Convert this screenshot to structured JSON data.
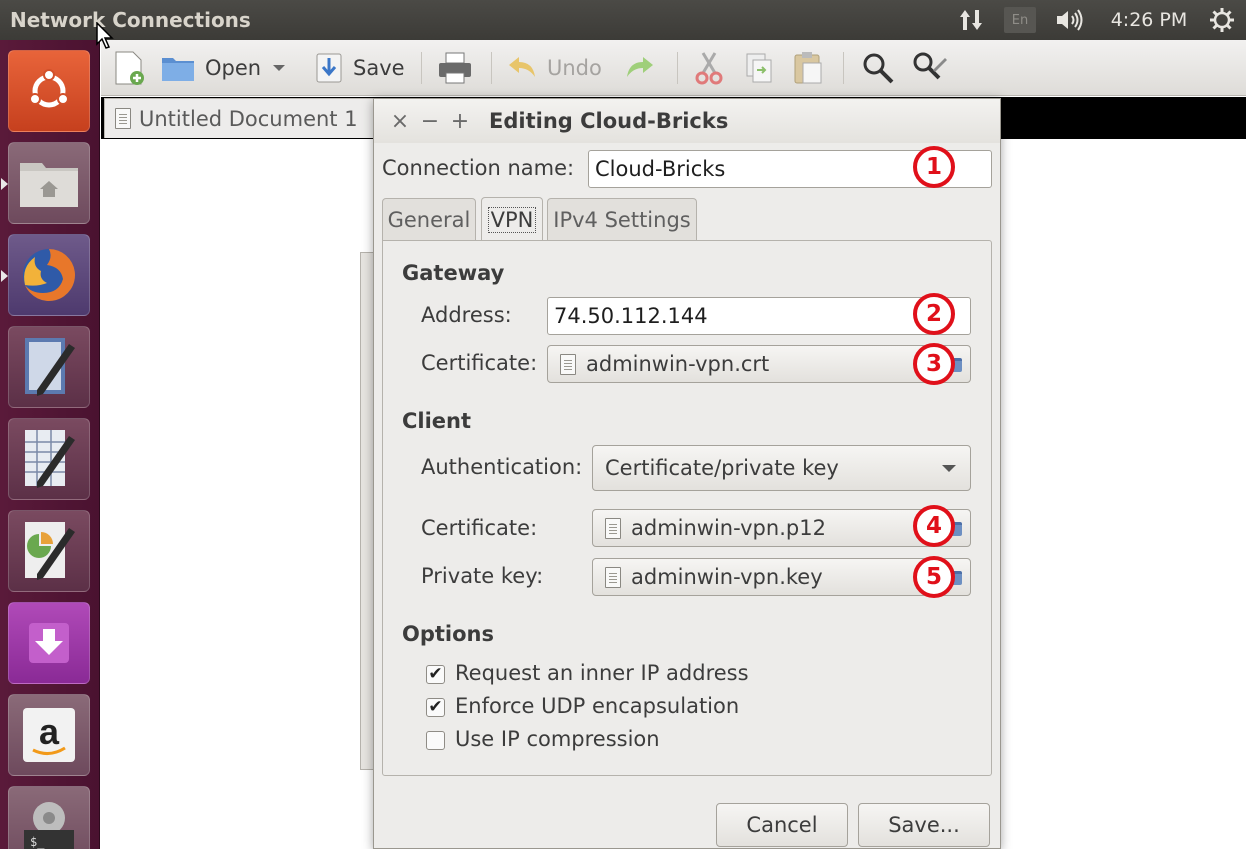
{
  "top_panel": {
    "title": "Network Connections",
    "keyboard_layout": "En",
    "clock": "4:26 PM"
  },
  "launcher": {
    "items": [
      "ubuntu-dash-icon",
      "files-icon",
      "firefox-icon",
      "libreoffice-writer-icon",
      "libreoffice-calc-icon",
      "libreoffice-impress-icon",
      "software-center-icon",
      "amazon-icon",
      "system-settings-icon"
    ]
  },
  "editor": {
    "toolbar": {
      "open": "Open",
      "save": "Save",
      "undo": "Undo"
    },
    "tab_title": "Untitled Document 1"
  },
  "dialog": {
    "title": "Editing Cloud-Bricks",
    "connection_name_label": "Connection name:",
    "connection_name_value": "Cloud-Bricks",
    "tabs": [
      {
        "label": "General"
      },
      {
        "label": "VPN"
      },
      {
        "label": "IPv4 Settings"
      }
    ],
    "gateway": {
      "heading": "Gateway",
      "address_label": "Address:",
      "address_value": "74.50.112.144",
      "certificate_label": "Certificate:",
      "certificate_value": "adminwin-vpn.crt"
    },
    "client": {
      "heading": "Client",
      "auth_label": "Authentication:",
      "auth_value": "Certificate/private key",
      "certificate_label": "Certificate:",
      "certificate_value": "adminwin-vpn.p12",
      "private_key_label": "Private key:",
      "private_key_value": "adminwin-vpn.key"
    },
    "options": {
      "heading": "Options",
      "items": [
        {
          "label": "Request an inner IP address",
          "checked": true
        },
        {
          "label": "Enforce UDP encapsulation",
          "checked": true
        },
        {
          "label": "Use IP compression",
          "checked": false
        }
      ]
    },
    "cancel": "Cancel",
    "save": "Save..."
  },
  "annotations": [
    "1",
    "2",
    "3",
    "4",
    "5"
  ],
  "colors": {
    "annotation_red": "#e0101a",
    "launcher_bg": "#5a1a3a",
    "panel_bg": "#3c3b37"
  }
}
